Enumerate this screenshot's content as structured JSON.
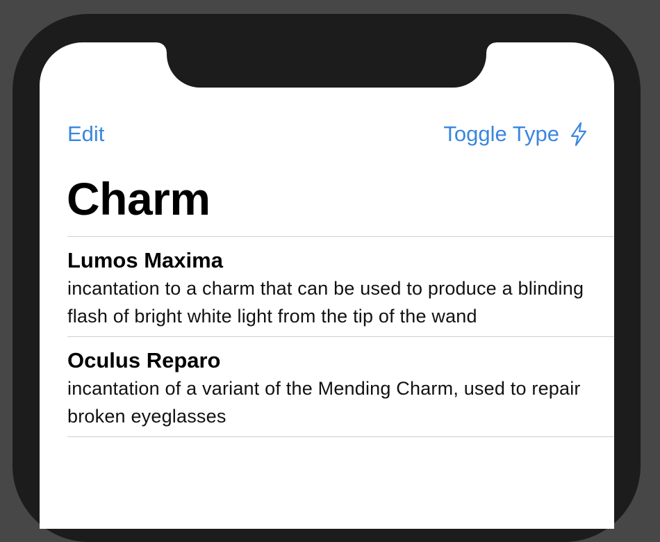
{
  "nav": {
    "edit_label": "Edit",
    "toggle_label": "Toggle Type",
    "toggle_icon": "bolt-icon"
  },
  "page": {
    "title": "Charm"
  },
  "spells": [
    {
      "name": "Lumos Maxima",
      "description": "incantation to a charm that can be used to produce a blinding flash of bright white light from the tip of the wand"
    },
    {
      "name": "Oculus Reparo",
      "description": "incantation of a variant of the Mending Charm, used to repair broken eyeglasses"
    }
  ],
  "colors": {
    "accent": "#3a86e0",
    "frame": "#1c1c1c",
    "background": "#474747",
    "separator": "#cfcfd3"
  }
}
